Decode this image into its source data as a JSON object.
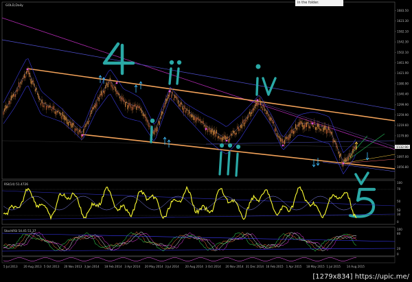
{
  "window": {
    "chart_label": "GOLD,Daily",
    "note_text": "in the folder."
  },
  "price_axis": {
    "labels": [
      "1683.50",
      "1623.30",
      "1582.10",
      "1542.30",
      "1502.10",
      "1461.90",
      "1421.00",
      "1380.90",
      "1340.40",
      "1299.90",
      "1259.90",
      "1219.60",
      "1179.80",
      "1137.00",
      "1097.00",
      "1056.80"
    ],
    "current_price": "1132.90"
  },
  "rsi": {
    "title": "RSI(14) 51.4726",
    "scale_labels": [
      "100",
      "70",
      "50",
      "30",
      "0"
    ],
    "scale_label_right": "52"
  },
  "stoch": {
    "title": "StochRSI 54.45 51.37",
    "scale_labels": [
      "100",
      "80",
      "20",
      "0"
    ]
  },
  "date_axis": {
    "labels": [
      "5 Jul 2013",
      "20 Aug 2013",
      "5 Oct 2013",
      "20 Nov 2013",
      "3 Jan 2014",
      "18 Feb 2014",
      "3 Apr 2014",
      "20 May 2014",
      "3 Jul 2014",
      "20 Aug 2014",
      "3 Oct 2014",
      "20 Nov 2014",
      "31 Dec 2014",
      "16 Feb 2015",
      "1 Apr 2015",
      "18 May 2015",
      "1 Jul 2015",
      "14 Aug 2015"
    ]
  },
  "wave_labels": [
    "4",
    "ii",
    "iv",
    "i",
    "iii",
    "v",
    "5"
  ],
  "watermark": "[1279x834] https://upic.me/",
  "colors": {
    "background": "#000000",
    "candle_up": "#c8813a",
    "candle_down": "#a0522d",
    "channel": "#f4a35a",
    "rsi_line": "#ffff33",
    "annotation": "#2aa9a6",
    "fractal": "#e050e0",
    "signal_arrow": "#40c0ff"
  }
}
